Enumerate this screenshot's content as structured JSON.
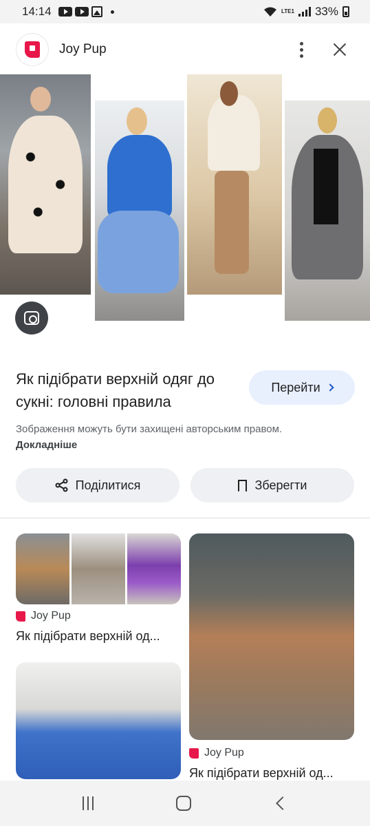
{
  "status_bar": {
    "time": "14:14",
    "battery": "33%",
    "lte_label": "LTE1",
    "icons": [
      "youtube-icon",
      "youtube-icon",
      "gallery-icon",
      "notification-dot-icon",
      "wifi-icon",
      "signal-icon",
      "battery-icon"
    ]
  },
  "header": {
    "site_name": "Joy Pup",
    "logo_icon": "joy-pup-logo-icon",
    "menu_icon": "more-vert-icon",
    "close_icon": "close-icon"
  },
  "hero": {
    "lens_icon": "google-lens-icon"
  },
  "result": {
    "title": "Як підібрати верхній одяг до сукні: головні правила",
    "visit_label": "Перейти",
    "disclaimer_text": "Зображення можуть бути захищені авторським правом.",
    "disclaimer_link": "Докладніше",
    "share_label": "Поділитися",
    "save_label": "Зберегти"
  },
  "related": [
    {
      "source": "Joy Pup",
      "caption": "Як підібрати верхній од..."
    },
    {
      "source": "Joy Pup",
      "caption": "Як підібрати верхній од..."
    },
    {
      "source": "",
      "caption": ""
    }
  ],
  "colors": {
    "brand": "#e8174a",
    "visit_button_bg": "#e8effd",
    "chip_bg": "#eef0f3",
    "lens_bg": "#3f4347"
  },
  "nav_bar": {
    "icons": [
      "recent-apps-icon",
      "home-icon",
      "back-icon"
    ]
  }
}
